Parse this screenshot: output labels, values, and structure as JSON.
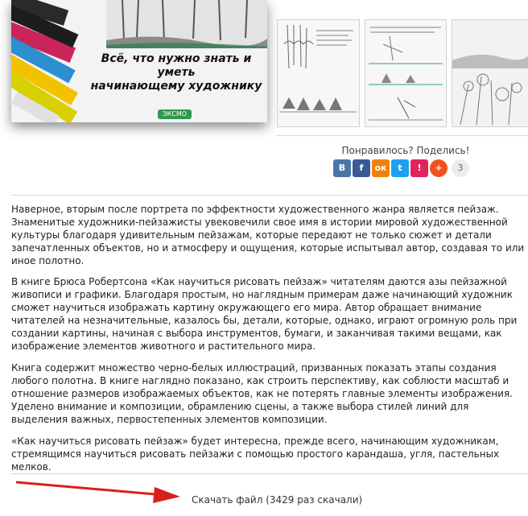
{
  "cover": {
    "title_line1": "Всё, что нужно знать и уметь",
    "title_line2": "начинающему художнику",
    "publisher": "ЭКСМО"
  },
  "share": {
    "prompt": "Понравилось? Поделись!",
    "buttons": [
      {
        "label": "В",
        "color": "#4a76a8"
      },
      {
        "label": "f",
        "color": "#3b5998"
      },
      {
        "label": "ок",
        "color": "#ee8208"
      },
      {
        "label": "t",
        "color": "#1da1f2"
      },
      {
        "label": "!",
        "color": "#e0245e"
      },
      {
        "label": "+",
        "color": "#f4511e"
      }
    ],
    "count": "3"
  },
  "description": {
    "p1": "Наверное, вторым после портрета по эффектности художественного жанра является пейзаж. Знаменитые художники-пейзажисты увековечили свое имя в истории мировой художественной культуры благодаря удивительным пейзажам, которые передают не только сюжет и детали запечатленных объектов, но и атмосферу и ощущения, которые испытывал автор, создавая то или иное полотно.",
    "p2": "В книге Брюса Робертсона «Как научиться рисовать пейзаж» читателям даются азы пейзажной живописи и графики. Благодаря простым, но наглядным примерам даже начинающий художник сможет научиться изображать картину окружающего его мира. Автор обращает внимание читателей на незначительные, казалось бы, детали, которые, однако, играют огромную роль при создании картины, начиная с выбора инструментов, бумаги, и заканчивая такими вещами, как изображение элементов животного и растительного мира.",
    "p3": "Книга содержит множество черно-белых иллюстраций, призванных показать этапы создания любого полотна. В книге наглядно показано, как строить перспективу, как соблюсти масштаб и отношение размеров изображаемых объектов, как не потерять главные элементы изображения. Уделено внимание и композиции, обрамлению сцены, а также выбора стилей линий для выделения важных, первостепенных элементов композиции.",
    "p4": "«Как научиться рисовать пейзаж» будет интересна, прежде всего, начинающим художникам, стремящимся научиться рисовать пейзажи с помощью простого карандаша, угля, пастельных мелков."
  },
  "download": {
    "label": "Скачать файл (3429 раз скачали)"
  },
  "colors": {
    "arrow": "#d9201a"
  }
}
